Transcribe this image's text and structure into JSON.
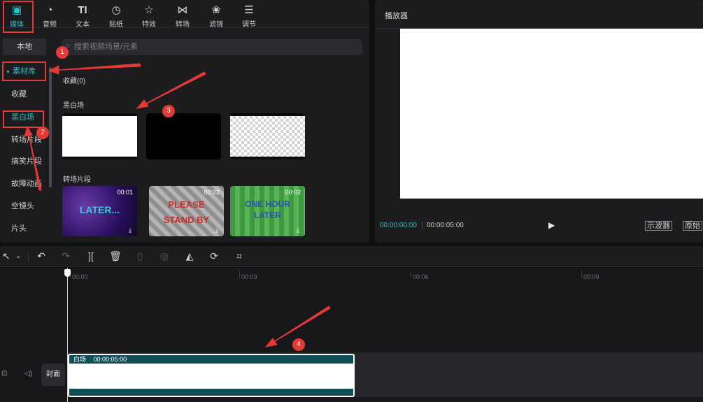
{
  "tabs": [
    {
      "label": "媒体",
      "icon": "media-icon",
      "active": true
    },
    {
      "label": "音频",
      "icon": "audio-icon"
    },
    {
      "label": "文本",
      "icon": "text-icon"
    },
    {
      "label": "贴纸",
      "icon": "sticker-icon"
    },
    {
      "label": "特效",
      "icon": "effects-icon"
    },
    {
      "label": "转场",
      "icon": "transition-icon"
    },
    {
      "label": "滤镜",
      "icon": "filter-icon"
    },
    {
      "label": "调节",
      "icon": "adjust-icon"
    }
  ],
  "sidebar": {
    "local": "本地",
    "library": "素材库",
    "items": [
      "收藏",
      "黑白场",
      "转场片段",
      "搞笑片段",
      "故障动画",
      "空镜头",
      "片头"
    ],
    "selected": "黑白场"
  },
  "content": {
    "search_placeholder": "搜索视频场景/元素",
    "favorites_label": "收藏(0)",
    "section_bw": "黑白场",
    "section_transition": "转场片段",
    "clips": [
      {
        "duration": "00:01",
        "text": "LATER...",
        "text_color": "#3ec6d9"
      },
      {
        "duration": "00:02",
        "text": "PLEASE STAND BY",
        "text_color": "#c0302c"
      },
      {
        "duration": "00:02",
        "text": "ONE HOUR LATER",
        "text_color": "#2c4fb0"
      }
    ]
  },
  "player": {
    "title": "播放器",
    "current_time": "00:00:00:00",
    "total_time": "00:00:05:00",
    "scope_button": "示波器",
    "original_button": "原始"
  },
  "timeline": {
    "ticks": [
      "00:00",
      "00:03",
      "00:06",
      "00:09"
    ],
    "cover_label": "封面",
    "clip_label": "白场",
    "clip_duration": "00:00:05:00"
  },
  "annotations": [
    "1",
    "2",
    "3",
    "4"
  ],
  "colors": {
    "accent": "#29c4c9",
    "annotation": "#e53935",
    "clip_bar": "#104f57"
  }
}
